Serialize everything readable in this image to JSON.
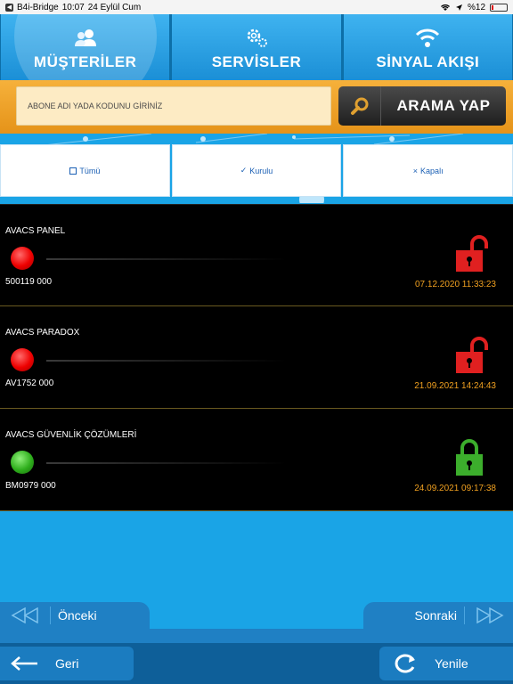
{
  "status_bar": {
    "back_app": "B4i-Bridge",
    "time": "10:07",
    "date": "24 Eylül Cum",
    "battery": "%12",
    "icons": [
      "wifi-icon",
      "location-icon",
      "battery-icon"
    ]
  },
  "topnav": {
    "tabs": [
      {
        "label": "MÜŞTERİLER",
        "icon": "users-icon",
        "active": true
      },
      {
        "label": "SERVİSLER",
        "icon": "gears-icon",
        "active": false
      },
      {
        "label": "SİNYAL AKIŞI",
        "icon": "wifi-icon",
        "active": false
      }
    ]
  },
  "search": {
    "placeholder": "ABONE ADI YADA KODUNU GİRİNİZ",
    "button_label": "ARAMA YAP",
    "button_icon": "magnifier-icon"
  },
  "filters": [
    {
      "label": "Tümü",
      "icon": "checkbox-empty-icon"
    },
    {
      "label": "Kurulu",
      "icon": "check-icon"
    },
    {
      "label": "Kapalı",
      "icon": "close-icon"
    }
  ],
  "customers": [
    {
      "name": "AVACS PANEL",
      "code": "500119 000",
      "status_color": "red",
      "lock": "unlocked",
      "datetime": "07.12.2020 11:33:23"
    },
    {
      "name": "AVACS PARADOX",
      "code": "AV1752 000",
      "status_color": "red",
      "lock": "unlocked",
      "datetime": "21.09.2021 14:24:43"
    },
    {
      "name": "AVACS GÜVENLİK ÇÖZÜMLERİ",
      "code": "BM0979 000",
      "status_color": "green",
      "lock": "locked",
      "datetime": "24.09.2021 09:17:38"
    }
  ],
  "pager": {
    "prev_label": "Önceki",
    "next_label": "Sonraki"
  },
  "bottom": {
    "back_label": "Geri",
    "refresh_label": "Yenile"
  },
  "colors": {
    "accent": "#1aa4e6",
    "search_bar": "#f0a52b",
    "unlocked": "#e02020",
    "locked": "#3cae2c",
    "date_text": "#f0a020"
  }
}
